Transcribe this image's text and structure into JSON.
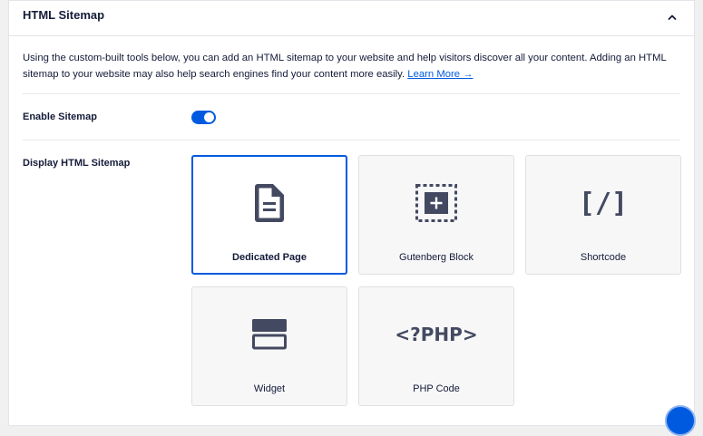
{
  "panel": {
    "title": "HTML Sitemap",
    "description": "Using the custom-built tools below, you can add an HTML sitemap to your website and help visitors discover all your content. Adding an HTML sitemap to your website may also help search engines find your content more easily.",
    "learn_more": "Learn More →"
  },
  "settings": {
    "enable_label": "Enable Sitemap",
    "enable_value": true,
    "display_label": "Display HTML Sitemap"
  },
  "options": [
    {
      "label": "Dedicated Page",
      "selected": true
    },
    {
      "label": "Gutenberg Block",
      "selected": false
    },
    {
      "label": "Shortcode",
      "selected": false
    },
    {
      "label": "Widget",
      "selected": false
    },
    {
      "label": "PHP Code",
      "selected": false
    }
  ],
  "icons": {
    "shortcode_glyph": "[/]",
    "php_glyph": "<?PHP>"
  },
  "colors": {
    "accent": "#005ae0",
    "text": "#141b38",
    "icon": "#434960"
  }
}
